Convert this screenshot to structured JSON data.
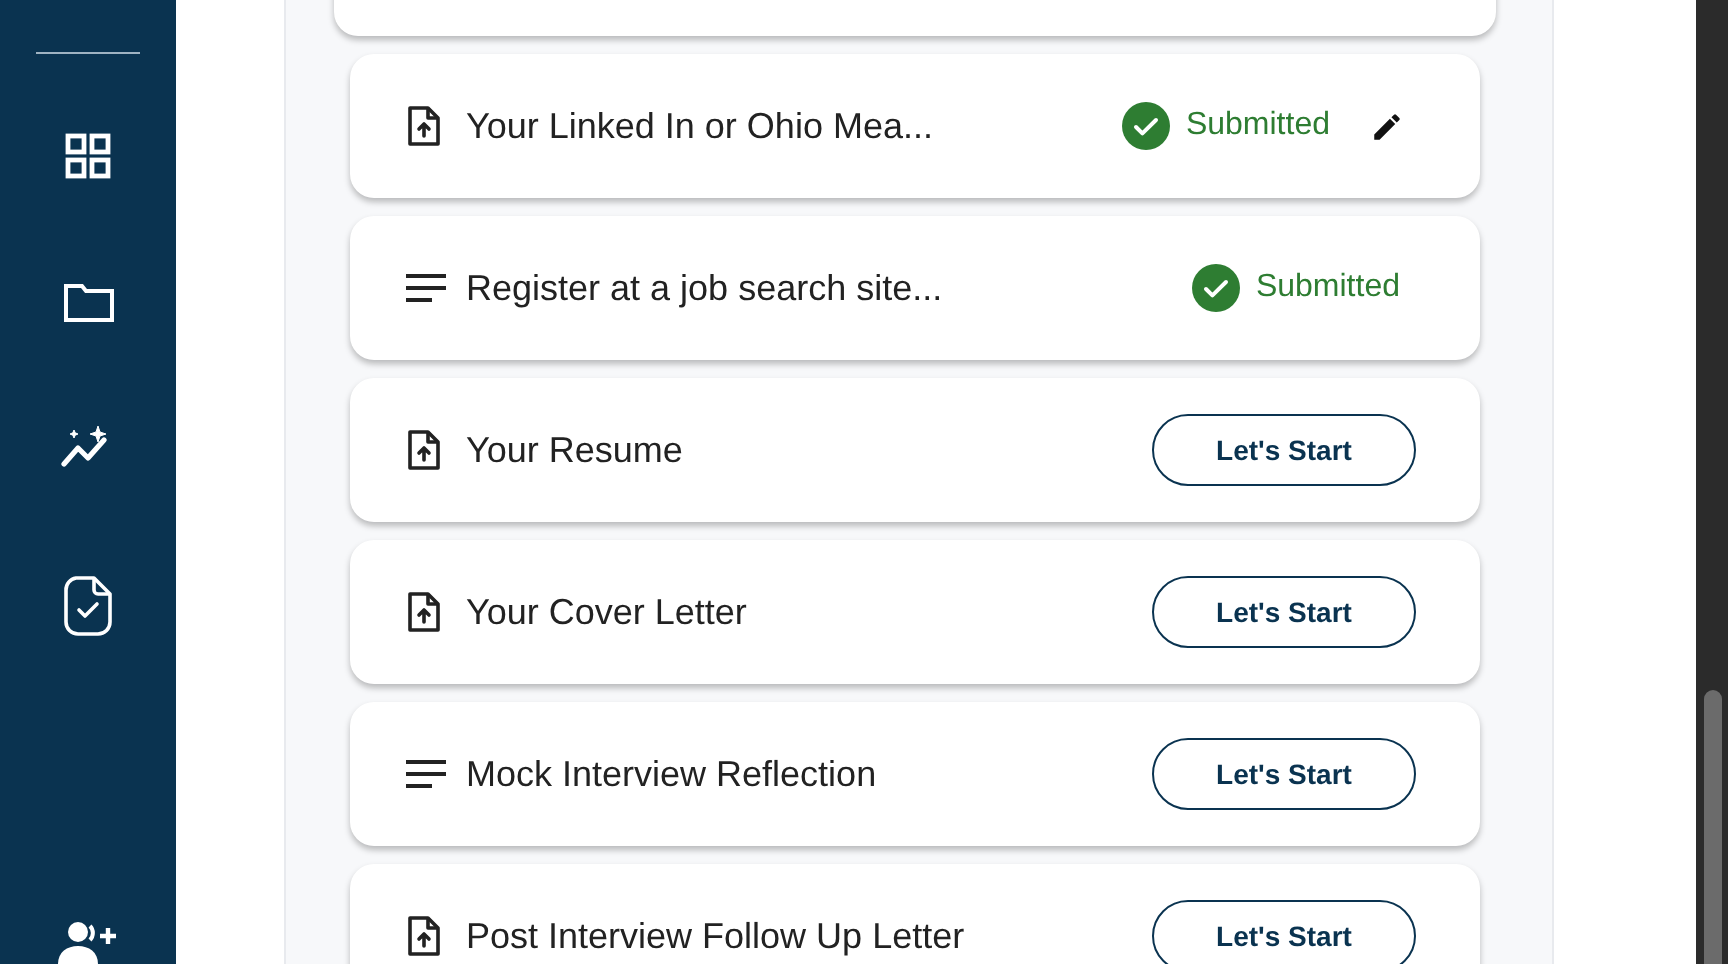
{
  "tasks": [
    {
      "kind": "upload",
      "title": "Your Linked In or Ohio Mea...",
      "status": "Submitted",
      "editable": true
    },
    {
      "kind": "text",
      "title": "Register at a job search site...",
      "status": "Submitted",
      "editable": false
    },
    {
      "kind": "upload",
      "title": "Your Resume",
      "action": "Let's Start"
    },
    {
      "kind": "upload",
      "title": "Your Cover Letter",
      "action": "Let's Start"
    },
    {
      "kind": "text",
      "title": "Mock Interview Reflection",
      "action": "Let's Start"
    },
    {
      "kind": "upload",
      "title": "Post Interview Follow Up Letter",
      "action": "Let's Start"
    }
  ]
}
